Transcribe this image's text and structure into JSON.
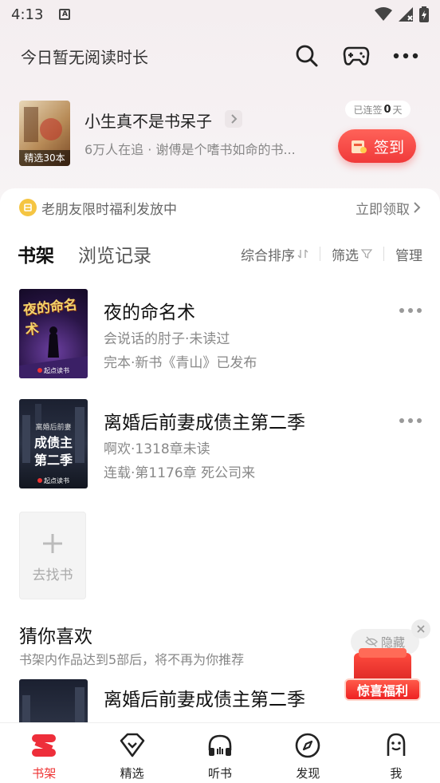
{
  "status_bar": {
    "time": "4:13",
    "sim_label": "A"
  },
  "header": {
    "title": "今日暂无阅读时长"
  },
  "promo": {
    "cover_badge": "精选30本",
    "book_title": "小生真不是书呆子",
    "description": "6万人在追 · 谢傅是个嗜书如命的书...",
    "checkin_prefix": "已连签",
    "checkin_days": "0",
    "checkin_suffix": "天",
    "checkin_label": "签到"
  },
  "welfare": {
    "text": "老朋友限时福利发放中",
    "claim_label": "立即领取"
  },
  "tabs": {
    "bookshelf": "书架",
    "history": "浏览记录",
    "sort": "综合排序",
    "filter": "筛选",
    "manage": "管理"
  },
  "books": [
    {
      "title": "夜的命名术",
      "meta1": "会说话的肘子·未读过",
      "meta2": "完本·新书《青山》已发布",
      "cover_text": "夜的命名术",
      "cover_pub": "起点读书"
    },
    {
      "title": "离婚后前妻成债主第二季",
      "meta1": "啊欢·1318章未读",
      "meta2": "连载·第1176章 死公司来",
      "cover_sub": "离婚后前妻",
      "cover_text_line1": "成债主",
      "cover_text_line2": "第二季",
      "cover_pub": "起点读书"
    }
  ],
  "add_book": {
    "label": "去找书"
  },
  "guess": {
    "title": "猜你喜欢",
    "subtitle": "书架内作品达到5部后，将不再为你推荐",
    "hide_label": "隐藏",
    "gift_label": "惊喜福利",
    "book_title": "离婚后前妻成债主第二季"
  },
  "nav": [
    {
      "label": "书架",
      "icon": "bookshelf-icon",
      "active": true
    },
    {
      "label": "精选",
      "icon": "diamond-icon"
    },
    {
      "label": "听书",
      "icon": "headphones-icon"
    },
    {
      "label": "发现",
      "icon": "compass-icon"
    },
    {
      "label": "我",
      "icon": "profile-icon"
    }
  ],
  "colors": {
    "accent": "#f03a3a",
    "text": "#222222",
    "muted": "#888888"
  }
}
